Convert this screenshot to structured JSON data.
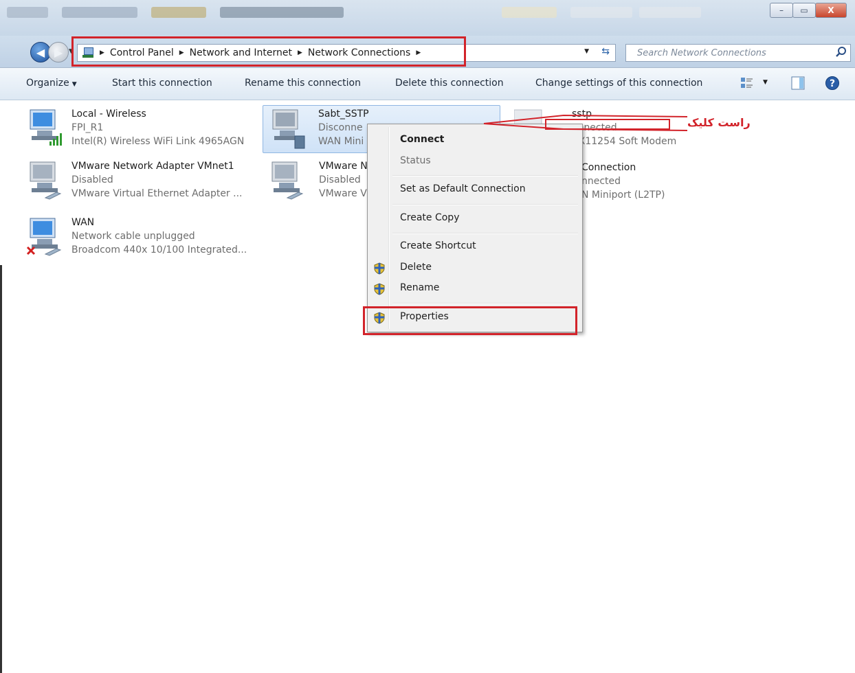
{
  "window": {
    "minimize": "–",
    "maximize": "▭",
    "close": "X"
  },
  "address": {
    "crumbs": [
      "Control Panel",
      "Network and Internet",
      "Network Connections"
    ]
  },
  "search": {
    "placeholder": "Search Network Connections"
  },
  "toolbar": {
    "organize": "Organize",
    "start": "Start this connection",
    "rename": "Rename this connection",
    "delete": "Delete this connection",
    "change": "Change settings of this connection"
  },
  "connections": [
    {
      "name": "Local - Wireless",
      "status": "FPI_R1",
      "device": "Intel(R) Wireless WiFi Link 4965AGN"
    },
    {
      "name": "Sabt_SSTP",
      "status": "Disconnected",
      "device": "WAN Miniport (SSTP)"
    },
    {
      "name": "sstp",
      "status": "Disconnected",
      "device": "Conexant CX11254 Soft Modem"
    },
    {
      "name": "VMware Network Adapter VMnet1",
      "status": "Disabled",
      "device": "VMware Virtual Ethernet Adapter ..."
    },
    {
      "name": "VMware Network Adapter VMnet8",
      "status": "Disabled",
      "device": "VMware Virtual Ethernet Adapter ..."
    },
    {
      "name": "VPN Connection",
      "status": "Disconnected",
      "device": "WAN Miniport (L2TP)"
    },
    {
      "name": "WAN",
      "status": "Network cable unplugged",
      "device": "Broadcom 440x 10/100 Integrated..."
    }
  ],
  "visible_text": {
    "c2_name": "Sabt_SSTP",
    "c2_status": "Disconne",
    "c2_device": "WAN Mini",
    "c3_name": "sstp",
    "c3_status": "onnected",
    "c3_device": "CX11254 Soft Modem",
    "c5_name": "VMware N",
    "c5_status": "Disabled",
    "c5_device": "VMware V",
    "c6_name": "Connection",
    "c6_status": "nnected",
    "c6_device": "N Miniport (L2TP)"
  },
  "menu": {
    "connect": "Connect",
    "status": "Status",
    "set_default": "Set as Default Connection",
    "create_copy": "Create Copy",
    "create_shortcut": "Create Shortcut",
    "delete": "Delete",
    "rename": "Rename",
    "properties": "Properties"
  },
  "annotation": {
    "text": "راست کلیک",
    "color": "#d2232a"
  },
  "colors": {
    "highlight": "#d2232a",
    "selection": "#cfe2f7",
    "menu_bg": "#f0f0f0"
  }
}
